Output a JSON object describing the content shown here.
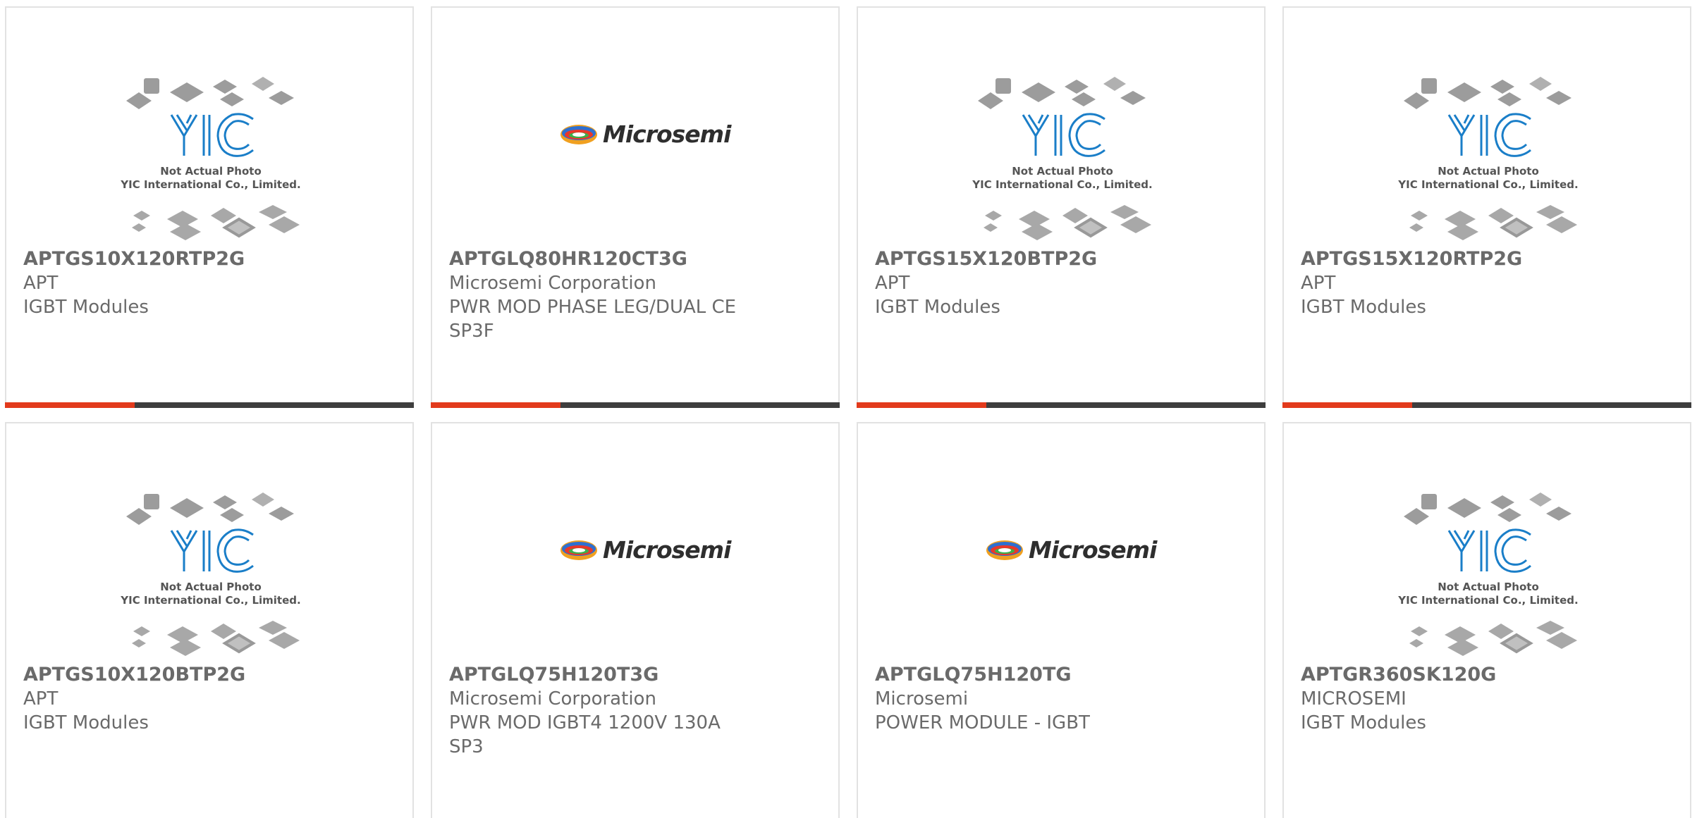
{
  "placeholder_caption": {
    "line1": "Not Actual Photo",
    "line2": "YIC International Co., Limited."
  },
  "logos": {
    "yic": "YIC",
    "microsemi": "Microsemi"
  },
  "colors": {
    "accent": "#e23a1c",
    "bar": "#3e3e3e",
    "text": "#6a6a6a",
    "border": "#e2e2e2"
  },
  "products": [
    {
      "part": "APTGS10X120RTP2G",
      "maker": "APT",
      "desc": "IGBT Modules"
    },
    {
      "part": "APTGLQ80HR120CT3G",
      "maker": "Microsemi Corporation",
      "desc": "PWR MOD PHASE LEG/DUAL CE",
      "desc2": "SP3F"
    },
    {
      "part": "APTGS15X120BTP2G",
      "maker": "APT",
      "desc": "IGBT Modules"
    },
    {
      "part": "APTGS15X120RTP2G",
      "maker": "APT",
      "desc": "IGBT Modules"
    },
    {
      "part": "APTGS10X120BTP2G",
      "maker": "APT",
      "desc": "IGBT Modules"
    },
    {
      "part": "APTGLQ75H120T3G",
      "maker": "Microsemi Corporation",
      "desc": "PWR MOD IGBT4 1200V 130A",
      "desc2": "SP3"
    },
    {
      "part": "APTGLQ75H120TG",
      "maker": "Microsemi",
      "desc": "POWER MODULE - IGBT"
    },
    {
      "part": "APTGR360SK120G",
      "maker": "MICROSEMI",
      "desc": "IGBT Modules"
    }
  ]
}
